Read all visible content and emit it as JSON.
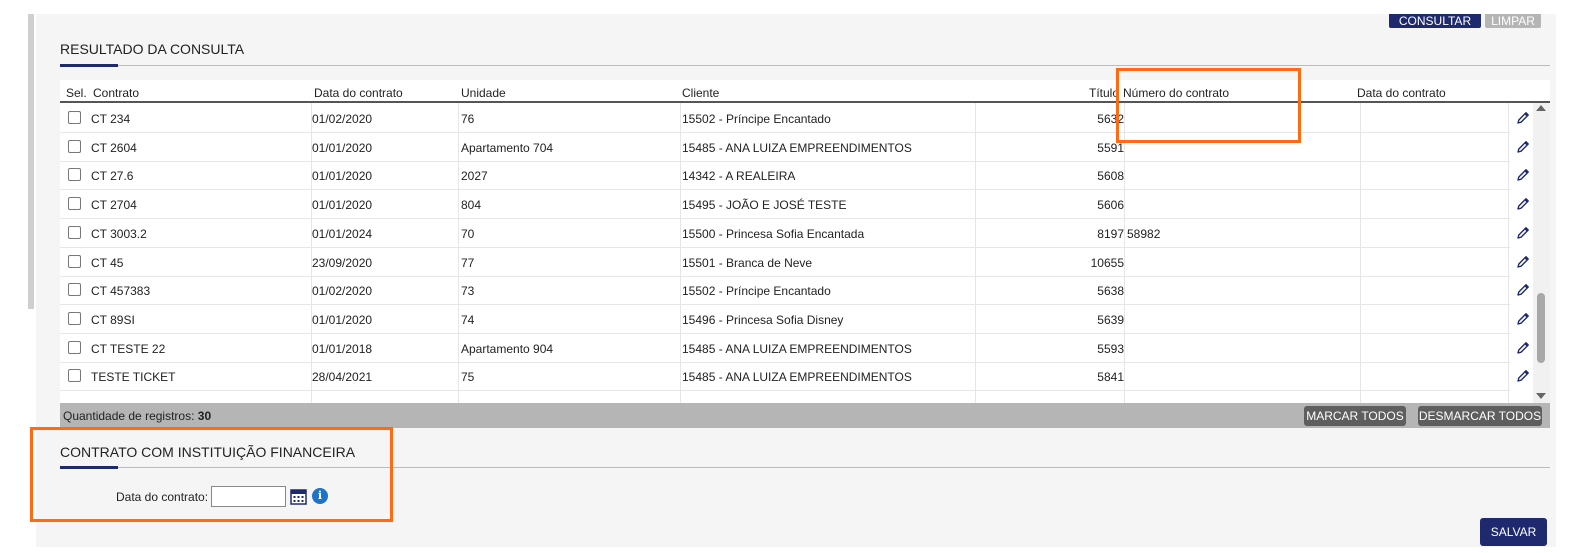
{
  "toolbar": {
    "consultar_label": "CONSULTAR",
    "limpar_label": "LIMPAR"
  },
  "result_section": {
    "title": "RESULTADO DA CONSULTA"
  },
  "grid": {
    "columns": [
      "Sel.",
      "Contrato",
      "Data do contrato",
      "Unidade",
      "Cliente",
      "Título",
      "Número do contrato",
      "Data do contrato"
    ],
    "rows": [
      {
        "contrato": "CT 234",
        "data": "01/02/2020",
        "unidade": "76",
        "cliente": "15502 - Príncipe Encantado",
        "titulo": "5632",
        "numero": "",
        "data2": ""
      },
      {
        "contrato": "CT 2604",
        "data": "01/01/2020",
        "unidade": "Apartamento 704",
        "cliente": "15485 - ANA LUIZA EMPREENDIMENTOS",
        "titulo": "5591",
        "numero": "",
        "data2": ""
      },
      {
        "contrato": "CT 27.6",
        "data": "01/01/2020",
        "unidade": "2027",
        "cliente": "14342 - A REALEIRA",
        "titulo": "5608",
        "numero": "",
        "data2": ""
      },
      {
        "contrato": "CT 2704",
        "data": "01/01/2020",
        "unidade": "804",
        "cliente": "15495 - JOÃO E JOSÉ TESTE",
        "titulo": "5606",
        "numero": "",
        "data2": ""
      },
      {
        "contrato": "CT 3003.2",
        "data": "01/01/2024",
        "unidade": "70",
        "cliente": "15500 - Princesa Sofia Encantada",
        "titulo": "8197",
        "numero": "58982",
        "data2": ""
      },
      {
        "contrato": "CT 45",
        "data": "23/09/2020",
        "unidade": "77",
        "cliente": "15501 - Branca de Neve",
        "titulo": "10655",
        "numero": "",
        "data2": ""
      },
      {
        "contrato": "CT 457383",
        "data": "01/02/2020",
        "unidade": "73",
        "cliente": "15502 - Príncipe Encantado",
        "titulo": "5638",
        "numero": "",
        "data2": ""
      },
      {
        "contrato": "CT 89SI",
        "data": "01/01/2020",
        "unidade": "74",
        "cliente": "15496 - Princesa Sofia Disney",
        "titulo": "5639",
        "numero": "",
        "data2": ""
      },
      {
        "contrato": "CT TESTE 22",
        "data": "01/01/2018",
        "unidade": "Apartamento 904",
        "cliente": "15485 - ANA LUIZA EMPREENDIMENTOS",
        "titulo": "5593",
        "numero": "",
        "data2": ""
      },
      {
        "contrato": "TESTE TICKET",
        "data": "28/04/2021",
        "unidade": "75",
        "cliente": "15485 - ANA LUIZA EMPREENDIMENTOS",
        "titulo": "5841",
        "numero": "",
        "data2": ""
      }
    ],
    "footer": {
      "count_label": "Quantidade de registros:",
      "count_value": "30",
      "marcar_label": "MARCAR TODOS",
      "desmarcar_label": "DESMARCAR TODOS"
    }
  },
  "financial_section": {
    "title": "CONTRATO COM INSTITUIÇÃO FINANCEIRA",
    "date_label": "Data do contrato:",
    "date_value": "",
    "info_glyph": "i"
  },
  "actions": {
    "salvar_label": "SALVAR"
  },
  "colors": {
    "primary": "#1f2a6e",
    "highlight": "#ff6a13",
    "footer_bg": "#b5b5b5",
    "info": "#1f73c4"
  }
}
